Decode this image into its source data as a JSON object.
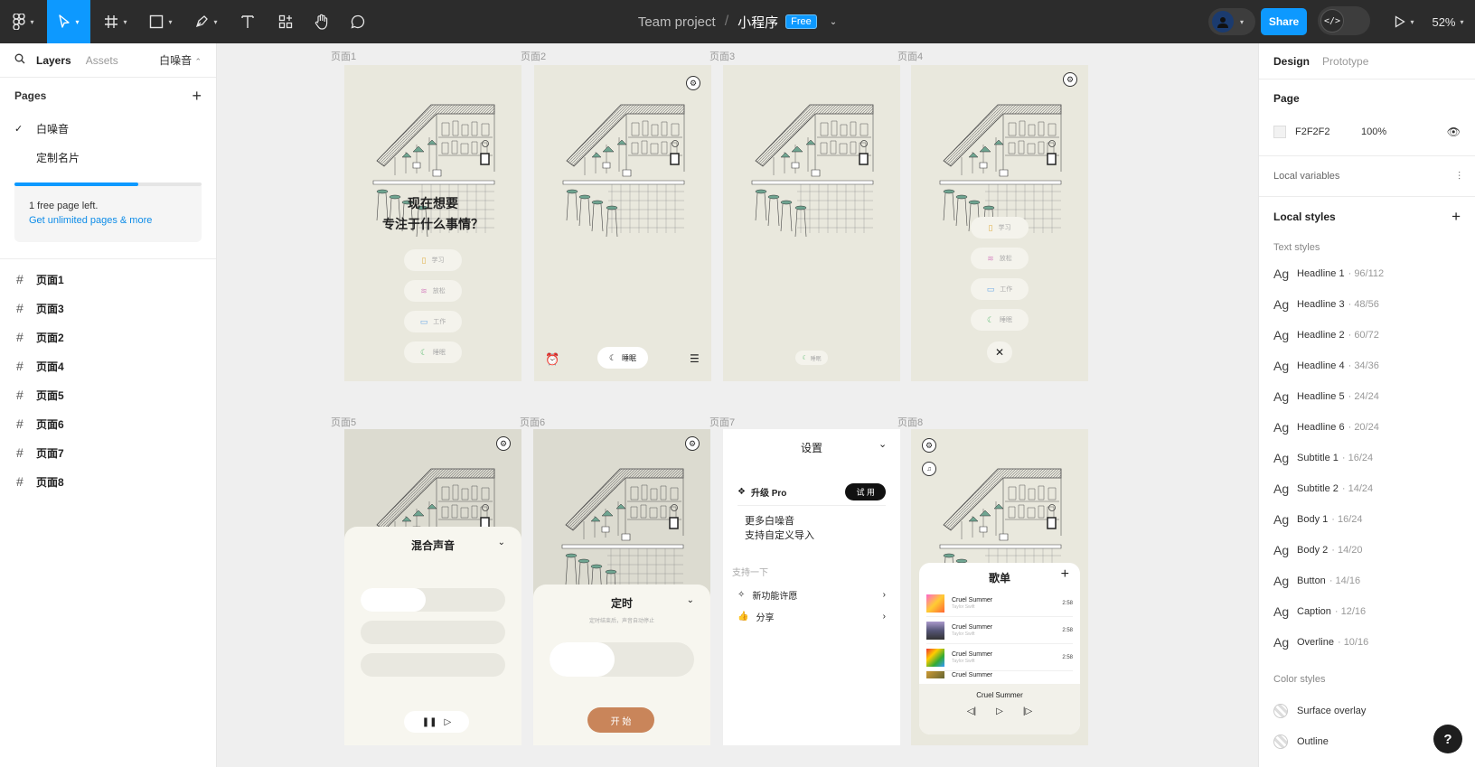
{
  "toolbar": {
    "project": "Team project",
    "separator": "/",
    "file_name": "小程序",
    "plan_badge": "Free",
    "share_label": "Share",
    "zoom": "52%",
    "tools": [
      "figma-menu-icon",
      "move-tool-icon",
      "frame-tool-icon",
      "shape-tool-icon",
      "pen-tool-icon",
      "text-tool-icon",
      "resources-icon",
      "hand-tool-icon",
      "comment-icon"
    ]
  },
  "left_panel": {
    "tabs": [
      "Layers",
      "Assets"
    ],
    "current_page": "白噪音",
    "pages_heading": "Pages",
    "pages": [
      "白噪音",
      "定制名片"
    ],
    "selected_page": "白噪音",
    "upsell_text": "1 free page left.",
    "upsell_link": "Get unlimited pages & more",
    "page_usage_fraction": 0.66,
    "layers": [
      "页面1",
      "页面3",
      "页面2",
      "页面4",
      "页面5",
      "页面6",
      "页面7",
      "页面8"
    ]
  },
  "right_panel": {
    "tabs": [
      "Design",
      "Prototype"
    ],
    "page_heading": "Page",
    "page_color": "F2F2F2",
    "page_opacity": "100%",
    "local_variables": "Local variables",
    "local_styles": "Local styles",
    "text_styles_heading": "Text styles",
    "text_styles": [
      {
        "ag": "Ag",
        "name": "Headline 1",
        "meta": "· 96/112"
      },
      {
        "ag": "Ag",
        "name": "Headline 3",
        "meta": "· 48/56"
      },
      {
        "ag": "Ag",
        "name": "Headline 2",
        "meta": "· 60/72"
      },
      {
        "ag": "Ag",
        "name": "Headline 4",
        "meta": "· 34/36"
      },
      {
        "ag": "Ag",
        "name": "Headline 5",
        "meta": "· 24/24"
      },
      {
        "ag": "Ag",
        "name": "Headline 6",
        "meta": "· 20/24"
      },
      {
        "ag": "Ag",
        "name": "Subtitle 1",
        "meta": "· 16/24"
      },
      {
        "ag": "Ag",
        "name": "Subtitle 2",
        "meta": "· 14/24"
      },
      {
        "ag": "Ag",
        "name": "Body 1",
        "meta": "· 16/24"
      },
      {
        "ag": "Ag",
        "name": "Body 2",
        "meta": "· 14/20"
      },
      {
        "ag": "Ag",
        "name": "Button",
        "meta": "· 14/16"
      },
      {
        "ag": "Ag",
        "name": "Caption",
        "meta": "· 12/16"
      },
      {
        "ag": "Ag",
        "name": "Overline",
        "meta": "· 10/16"
      }
    ],
    "color_styles_heading": "Color styles",
    "color_styles": [
      "Surface overlay",
      "Outline"
    ],
    "help": "?"
  },
  "canvas": {
    "frame_labels": [
      "页面1",
      "页面2",
      "页面3",
      "页面4",
      "页面5",
      "页面6",
      "页面7",
      "页面8"
    ],
    "p1": {
      "question_line1": "现在想要",
      "question_line2": "专注于什么事情？",
      "options": [
        "学习",
        "放松",
        "工作",
        "睡眠"
      ]
    },
    "p2": {
      "mode": "睡眠"
    },
    "p3": {
      "mode": "睡眠"
    },
    "p4": {
      "options": [
        "学习",
        "放松",
        "工作",
        "睡眠"
      ]
    },
    "p5": {
      "title": "混合声音"
    },
    "p6": {
      "title": "定时",
      "subtitle": "定时结束后，声音自动停止",
      "start": "开 始"
    },
    "p7": {
      "title": "设置",
      "pro_label": "升级 Pro",
      "trial_label": "试 用",
      "more_line1": "更多白噪音",
      "more_line2": "支持自定义导入",
      "support_heading": "支持一下",
      "support_items": [
        "新功能许愿",
        "分享"
      ]
    },
    "p8": {
      "title": "歌单",
      "songs": [
        {
          "title": "Cruel Summer",
          "artist": "Taylor Swift",
          "duration": "2:58"
        },
        {
          "title": "Cruel Summer",
          "artist": "Taylor Swift",
          "duration": "2:58"
        },
        {
          "title": "Cruel Summer",
          "artist": "Taylor Swift",
          "duration": "2:58"
        },
        {
          "title": "Cruel Summer",
          "artist": "",
          "duration": ""
        }
      ],
      "now_playing": "Cruel Summer"
    }
  },
  "colors": {
    "toolbar_bg": "#2c2c2c",
    "accent": "#0d99ff",
    "frame_bg": "#e9e8dd",
    "start_button": "#c9855a",
    "awning_green": "#6fa591"
  }
}
